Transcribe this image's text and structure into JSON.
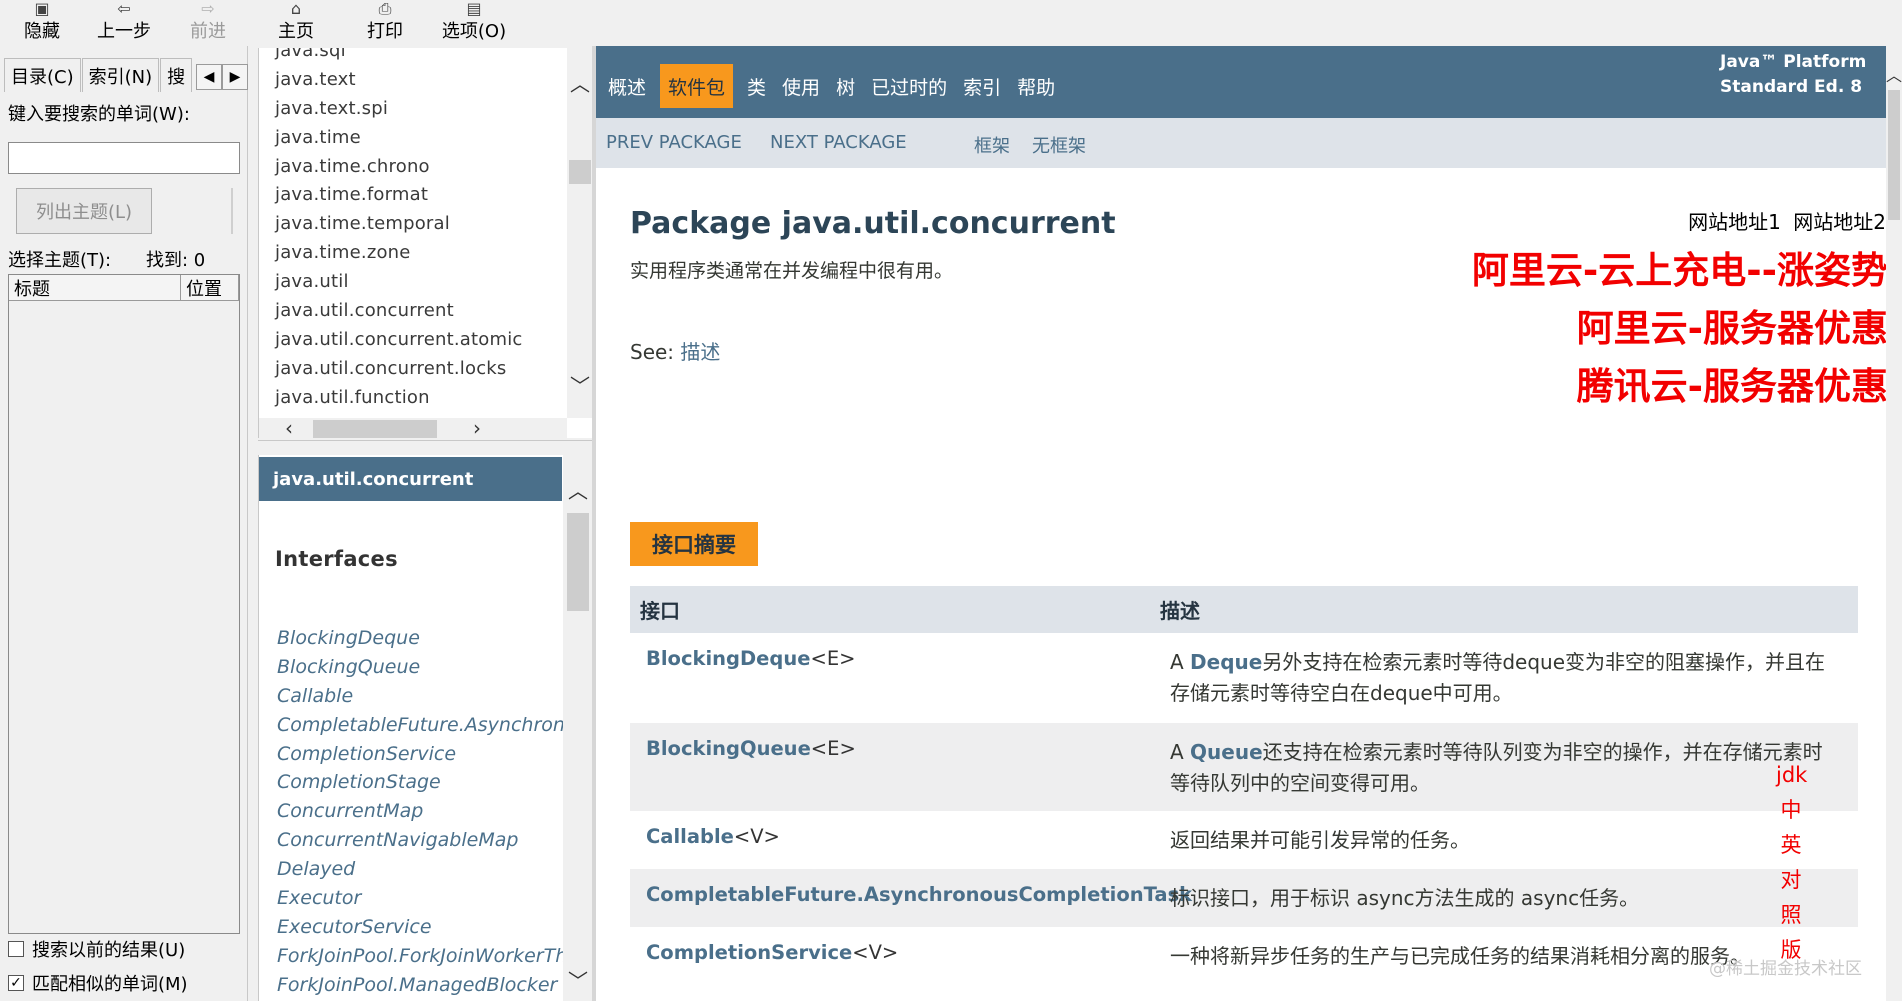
{
  "toolbar": {
    "hide": "隐藏",
    "back": "上一步",
    "forward": "前进",
    "home": "主页",
    "print": "打印",
    "options": "选项(O)"
  },
  "left_pane": {
    "tabs": [
      "目录(C)",
      "索引(N)",
      "搜"
    ],
    "search_label": "键入要搜索的单词(W):",
    "search_value": "",
    "list_topics_button": "列出主题(L)",
    "select_topic_label": "选择主题(T):",
    "found_label": "找到: 0",
    "columns": [
      "标题",
      "位置"
    ],
    "search_previous_label": "搜索以前的结果(U)",
    "match_similar_label": "匹配相似的单词(M)",
    "search_previous_checked": false,
    "match_similar_checked": true
  },
  "packages": [
    "java.sql",
    "java.text",
    "java.text.spi",
    "java.time",
    "java.time.chrono",
    "java.time.format",
    "java.time.temporal",
    "java.time.zone",
    "java.util",
    "java.util.concurrent",
    "java.util.concurrent.atomic",
    "java.util.concurrent.locks",
    "java.util.function"
  ],
  "class_frame": {
    "header": "java.util.concurrent",
    "section_title": "Interfaces",
    "items": [
      "BlockingDeque",
      "BlockingQueue",
      "Callable",
      "CompletableFuture.AsynchronousCompletionTask",
      "CompletionService",
      "CompletionStage",
      "ConcurrentMap",
      "ConcurrentNavigableMap",
      "Delayed",
      "Executor",
      "ExecutorService",
      "ForkJoinPool.ForkJoinWorkerThreadFactory",
      "ForkJoinPool.ManagedBlocker"
    ]
  },
  "main": {
    "nav": [
      "概述",
      "软件包",
      "类",
      "使用",
      "树",
      "已过时的",
      "索引",
      "帮助"
    ],
    "nav_active": "软件包",
    "platform_line1": "Java™ Platform",
    "platform_line2": "Standard Ed. 8",
    "subnav": {
      "prev": "PREV PACKAGE",
      "next": "NEXT PACKAGE",
      "frames": "框架",
      "no_frames": "无框架"
    },
    "title": "Package java.util.concurrent",
    "description": "实用程序类通常在并发编程中很有用。",
    "see_label": "See:",
    "see_link": "描述",
    "site_links": [
      "网站地址1",
      "网站地址2"
    ],
    "ads": [
      "阿里云-云上充电--涨姿势",
      "阿里云-服务器优惠",
      "腾讯云-服务器优惠"
    ],
    "summary_tag": "接口摘要",
    "table_headers": [
      "接口",
      "描述"
    ],
    "rows": [
      {
        "name": "BlockingDeque",
        "generic": "<E>",
        "desc_prefix": "A ",
        "desc_code": "Deque",
        "desc_rest": "另外支持在检索元素时等待deque变为非空的阻塞操作，并且在存储元素时等待空白在deque中可用。"
      },
      {
        "name": "BlockingQueue",
        "generic": "<E>",
        "desc_prefix": "A ",
        "desc_code": "Queue",
        "desc_rest": "还支持在检索元素时等待队列变为非空的操作，并在存储元素时等待队列中的空间变得可用。"
      },
      {
        "name": "Callable",
        "generic": "<V>",
        "desc_prefix": "",
        "desc_code": "",
        "desc_rest": "返回结果并可能引发异常的任务。"
      },
      {
        "name": "CompletableFuture.AsynchronousCompletionTask",
        "generic": "",
        "desc_prefix": "",
        "desc_code": "",
        "desc_rest": "标识接口，用于标识 async方法生成的 async任务。"
      },
      {
        "name": "CompletionService",
        "generic": "<V>",
        "desc_prefix": "",
        "desc_code": "",
        "desc_rest": "一种将新异步任务的生产与已完成任务的结果消耗相分离的服务。"
      }
    ],
    "vertical_label": [
      "jdk",
      "中",
      "英",
      "对",
      "照",
      "版"
    ],
    "watermark": "@稀土掘金技术社区"
  }
}
